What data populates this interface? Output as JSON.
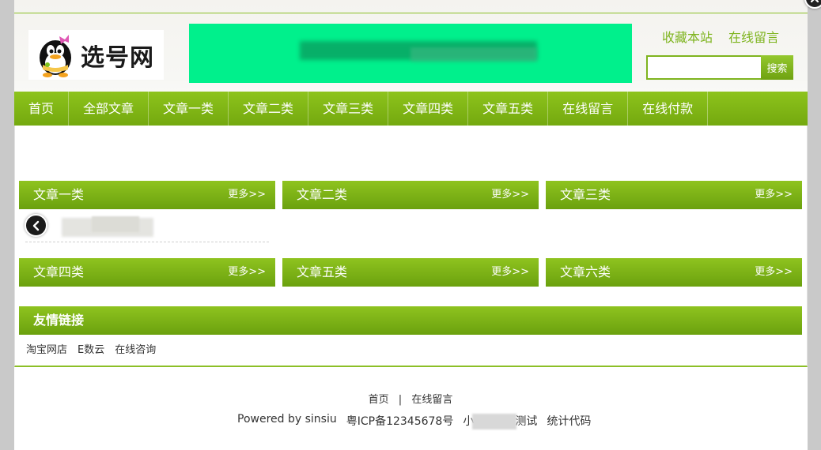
{
  "header": {
    "logo_text": "选号网",
    "top_links": [
      "收藏本站",
      "在线留言"
    ],
    "search": {
      "placeholder": "",
      "button_label": "搜索"
    }
  },
  "nav": {
    "items": [
      "首页",
      "全部文章",
      "文章一类",
      "文章二类",
      "文章三类",
      "文章四类",
      "文章五类",
      "在线留言",
      "在线付款"
    ]
  },
  "panels": [
    {
      "title": "文章一类",
      "more": "更多>>"
    },
    {
      "title": "文章二类",
      "more": "更多>>"
    },
    {
      "title": "文章三类",
      "more": "更多>>"
    },
    {
      "title": "文章四类",
      "more": "更多>>"
    },
    {
      "title": "文章五类",
      "more": "更多>>"
    },
    {
      "title": "文章六类",
      "more": "更多>>"
    }
  ],
  "friend_links": {
    "title": "友情链接",
    "items": [
      "淘宝网店",
      "E数云",
      "在线咨询"
    ]
  },
  "footer": {
    "nav": [
      "首页",
      "在线留言"
    ],
    "separator": "|",
    "powered_by": "Powered by sinsiu",
    "icp": "粤ICP备12345678号",
    "test_prefix": "小",
    "test_suffix": "测试",
    "stats": "统计代码"
  },
  "colors": {
    "brand_green": "#7eb41e",
    "banner": "#00f08c"
  }
}
